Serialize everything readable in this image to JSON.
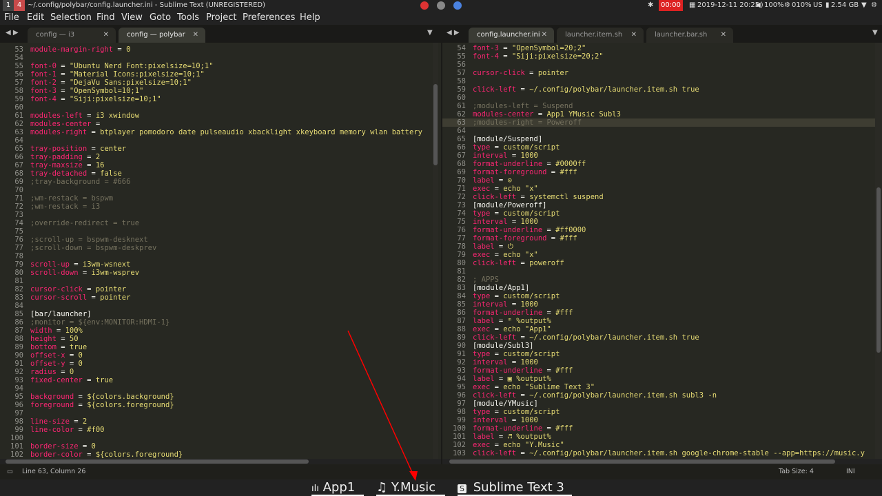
{
  "topbar": {
    "workspaces": [
      "1",
      "4"
    ],
    "window_title": "~/.config/polybar/config.launcher.ini - Sublime Text (UNREGISTERED)",
    "recorder": "00:00",
    "datetime": "2019-12-11 20:25",
    "volume": "100%",
    "cpu": "010%",
    "keyboard": "US",
    "memory": "2.54 GB"
  },
  "menu": [
    "File",
    "Edit",
    "Selection",
    "Find",
    "View",
    "Goto",
    "Tools",
    "Project",
    "Preferences",
    "Help"
  ],
  "left_tabs": [
    {
      "label": "config — i3"
    },
    {
      "label": "config — polybar"
    }
  ],
  "right_tabs": [
    {
      "label": "config.launcher.ini"
    },
    {
      "label": "launcher.item.sh"
    },
    {
      "label": "launcher.bar.sh"
    }
  ],
  "left_lines": [
    {
      "n": "53",
      "k": "module-margin-right",
      "v": "0"
    },
    {
      "n": "54",
      "k": "",
      "v": ""
    },
    {
      "n": "55",
      "k": "font-0",
      "v": "\"Ubuntu Nerd Font:pixelsize=10;1\""
    },
    {
      "n": "56",
      "k": "font-1",
      "v": "\"Material Icons:pixelsize=10;1\""
    },
    {
      "n": "57",
      "k": "font-2",
      "v": "\"DejaVu Sans:pixelsize=10;1\""
    },
    {
      "n": "58",
      "k": "font-3",
      "v": "\"OpenSymbol=10;1\""
    },
    {
      "n": "59",
      "k": "font-4",
      "v": "\"Siji:pixelsize=10;1\""
    },
    {
      "n": "60",
      "k": "",
      "v": ""
    },
    {
      "n": "61",
      "k": "modules-left",
      "v": "i3 xwindow"
    },
    {
      "n": "62",
      "k": "modules-center",
      "v": ""
    },
    {
      "n": "63",
      "k": "modules-right",
      "v": "btplayer pomodoro date pulseaudio xbacklight xkeyboard memory wlan battery"
    },
    {
      "n": "64",
      "k": "",
      "v": ""
    },
    {
      "n": "65",
      "k": "tray-position",
      "v": "center"
    },
    {
      "n": "66",
      "k": "tray-padding",
      "v": "2"
    },
    {
      "n": "67",
      "k": "tray-maxsize",
      "v": "16"
    },
    {
      "n": "68",
      "k": "tray-detached",
      "v": "false"
    },
    {
      "n": "69",
      "c": ";tray-background = #666"
    },
    {
      "n": "70",
      "k": "",
      "v": ""
    },
    {
      "n": "71",
      "c": ";wm-restack = bspwm"
    },
    {
      "n": "72",
      "c": ";wm-restack = i3"
    },
    {
      "n": "73",
      "k": "",
      "v": ""
    },
    {
      "n": "74",
      "c": ";override-redirect = true"
    },
    {
      "n": "75",
      "k": "",
      "v": ""
    },
    {
      "n": "76",
      "c": ";scroll-up = bspwm-desknext"
    },
    {
      "n": "77",
      "c": ";scroll-down = bspwm-deskprev"
    },
    {
      "n": "78",
      "k": "",
      "v": ""
    },
    {
      "n": "79",
      "k": "scroll-up",
      "v": "i3wm-wsnext"
    },
    {
      "n": "80",
      "k": "scroll-down",
      "v": "i3wm-wsprev"
    },
    {
      "n": "81",
      "k": "",
      "v": ""
    },
    {
      "n": "82",
      "k": "cursor-click",
      "v": "pointer"
    },
    {
      "n": "83",
      "k": "cursor-scroll",
      "v": "pointer"
    },
    {
      "n": "84",
      "k": "",
      "v": ""
    },
    {
      "n": "85",
      "s": "[bar/launcher]"
    },
    {
      "n": "86",
      "c": ";monitor = ${env:MONITOR:HDMI-1}"
    },
    {
      "n": "87",
      "k": "width",
      "v": "100%"
    },
    {
      "n": "88",
      "k": "height",
      "v": "50"
    },
    {
      "n": "89",
      "k": "bottom",
      "v": "true"
    },
    {
      "n": "90",
      "k": "offset-x",
      "v": "0"
    },
    {
      "n": "91",
      "k": "offset-y",
      "v": "0"
    },
    {
      "n": "92",
      "k": "radius",
      "v": "0"
    },
    {
      "n": "93",
      "k": "fixed-center",
      "v": "true"
    },
    {
      "n": "94",
      "k": "",
      "v": ""
    },
    {
      "n": "95",
      "k": "background",
      "v": "${colors.background}"
    },
    {
      "n": "96",
      "k": "foreground",
      "v": "${colors.foreground}"
    },
    {
      "n": "97",
      "k": "",
      "v": ""
    },
    {
      "n": "98",
      "k": "line-size",
      "v": "2"
    },
    {
      "n": "99",
      "k": "line-color",
      "v": "#f00"
    },
    {
      "n": "100",
      "k": "",
      "v": ""
    },
    {
      "n": "101",
      "k": "border-size",
      "v": "0"
    },
    {
      "n": "102",
      "k": "border-color",
      "v": "${colors.foreground}"
    }
  ],
  "right_lines": [
    {
      "n": "54",
      "k": "font-3",
      "v": "\"OpenSymbol=20;2\""
    },
    {
      "n": "55",
      "k": "font-4",
      "v": "\"Siji:pixelsize=20;2\""
    },
    {
      "n": "56",
      "k": "",
      "v": ""
    },
    {
      "n": "57",
      "k": "cursor-click",
      "v": "pointer"
    },
    {
      "n": "58",
      "k": "",
      "v": ""
    },
    {
      "n": "59",
      "k": "click-left",
      "v": "~/.config/polybar/launcher.item.sh true"
    },
    {
      "n": "60",
      "k": "",
      "v": ""
    },
    {
      "n": "61",
      "c": ";modules-left = Suspend"
    },
    {
      "n": "62",
      "k": "modules-center",
      "v": "App1 YMusic Subl3"
    },
    {
      "n": "63",
      "c": ";modules-right = Poweroff",
      "cur": true
    },
    {
      "n": "64",
      "k": "",
      "v": ""
    },
    {
      "n": "65",
      "s": "[module/Suspend]"
    },
    {
      "n": "66",
      "k": "type",
      "v": "custom/script"
    },
    {
      "n": "67",
      "k": "interval",
      "v": "1000"
    },
    {
      "n": "68",
      "k": "format-underline",
      "v": "#0000ff"
    },
    {
      "n": "69",
      "k": "format-foreground",
      "v": "#fff"
    },
    {
      "n": "70",
      "k": "label",
      "v": "⊙"
    },
    {
      "n": "71",
      "k": "exec",
      "v": "echo \"x\""
    },
    {
      "n": "72",
      "k": "click-left",
      "v": "systemctl suspend"
    },
    {
      "n": "73",
      "s": "[module/Poweroff]"
    },
    {
      "n": "74",
      "k": "type",
      "v": "custom/script"
    },
    {
      "n": "75",
      "k": "interval",
      "v": "1000"
    },
    {
      "n": "76",
      "k": "format-underline",
      "v": "#ff0000"
    },
    {
      "n": "77",
      "k": "format-foreground",
      "v": "#fff"
    },
    {
      "n": "78",
      "k": "label",
      "v": "⏻"
    },
    {
      "n": "79",
      "k": "exec",
      "v": "echo \"x\""
    },
    {
      "n": "80",
      "k": "click-left",
      "v": "poweroff"
    },
    {
      "n": "81",
      "k": "",
      "v": ""
    },
    {
      "n": "82",
      "c": "; APPS"
    },
    {
      "n": "83",
      "s": "[module/App1]"
    },
    {
      "n": "84",
      "k": "type",
      "v": "custom/script"
    },
    {
      "n": "85",
      "k": "interval",
      "v": "1000"
    },
    {
      "n": "86",
      "k": "format-underline",
      "v": "#fff"
    },
    {
      "n": "87",
      "k": "label",
      "v": "ᵐ %output%"
    },
    {
      "n": "88",
      "k": "exec",
      "v": "echo \"App1\""
    },
    {
      "n": "89",
      "k": "click-left",
      "v": "~/.config/polybar/launcher.item.sh true"
    },
    {
      "n": "90",
      "s": "[module/Subl3]"
    },
    {
      "n": "91",
      "k": "type",
      "v": "custom/script"
    },
    {
      "n": "92",
      "k": "interval",
      "v": "1000"
    },
    {
      "n": "93",
      "k": "format-underline",
      "v": "#fff"
    },
    {
      "n": "94",
      "k": "label",
      "v": "▣ %output%"
    },
    {
      "n": "95",
      "k": "exec",
      "v": "echo \"Sublime Text 3\""
    },
    {
      "n": "96",
      "k": "click-left",
      "v": "~/.config/polybar/launcher.item.sh subl3 -n"
    },
    {
      "n": "97",
      "s": "[module/YMusic]"
    },
    {
      "n": "98",
      "k": "type",
      "v": "custom/script"
    },
    {
      "n": "99",
      "k": "interval",
      "v": "1000"
    },
    {
      "n": "100",
      "k": "format-underline",
      "v": "#fff"
    },
    {
      "n": "101",
      "k": "label",
      "v": "♬ %output%"
    },
    {
      "n": "102",
      "k": "exec",
      "v": "echo \"Y.Music\""
    },
    {
      "n": "103",
      "k": "click-left",
      "v": "~/.config/polybar/launcher.item.sh google-chrome-stable --app=https://music.y"
    }
  ],
  "statusbar": {
    "position": "Line 63, Column 26",
    "tab_size": "Tab Size: 4",
    "syntax": "INI"
  },
  "launcher": [
    {
      "icon": "ılı",
      "label": "App1"
    },
    {
      "icon": "♫",
      "label": "Y.Music"
    },
    {
      "icon": "S",
      "label": "Sublime Text 3"
    }
  ],
  "colors": {
    "key": "#f92672",
    "value": "#e6db74",
    "comment": "#75715e",
    "bg": "#272822",
    "annotation": "#ff0000"
  }
}
